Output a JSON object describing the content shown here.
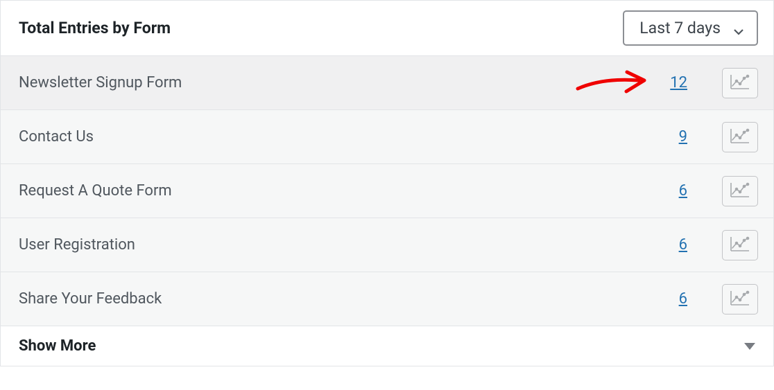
{
  "header": {
    "title": "Total Entries by Form",
    "dropdown_value": "Last 7 days"
  },
  "rows": [
    {
      "label": "Newsletter Signup Form",
      "count": "12",
      "highlighted": true
    },
    {
      "label": "Contact Us",
      "count": "9",
      "highlighted": false
    },
    {
      "label": "Request A Quote Form",
      "count": "6",
      "highlighted": false
    },
    {
      "label": "User Registration",
      "count": "6",
      "highlighted": false
    },
    {
      "label": "Share Your Feedback",
      "count": "6",
      "highlighted": false
    }
  ],
  "footer": {
    "label": "Show More"
  },
  "colors": {
    "link": "#2271b1",
    "annotation": "#ef0000"
  }
}
